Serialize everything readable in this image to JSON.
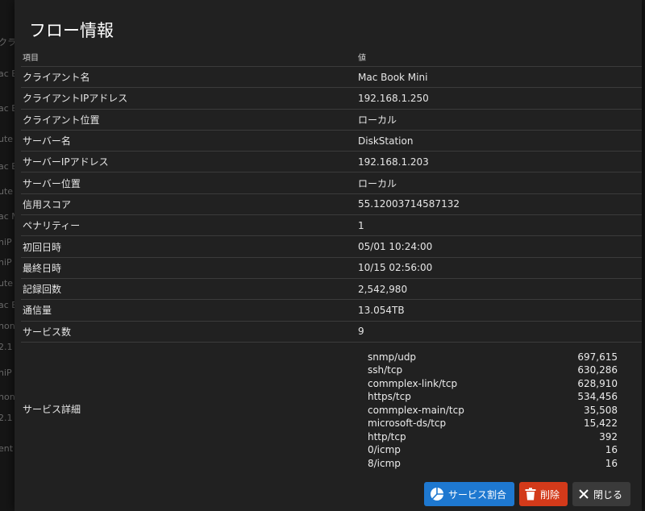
{
  "background_fragments": [
    "クライ",
    "ac B",
    "ac B",
    "ute",
    "ac B",
    "ute",
    "ac M",
    "niP",
    "niP",
    "ute",
    "ac B",
    "hon",
    "2.1",
    "niP",
    "hon",
    "2.1",
    "ent"
  ],
  "dialog": {
    "title": "フロー情報",
    "table": {
      "headers": {
        "item": "項目",
        "value": "値"
      },
      "rows": [
        {
          "label": "クライアント名",
          "value": "Mac Book Mini"
        },
        {
          "label": "クライアントIPアドレス",
          "value": "192.168.1.250"
        },
        {
          "label": "クライアント位置",
          "value": "ローカル"
        },
        {
          "label": "サーバー名",
          "value": "DiskStation"
        },
        {
          "label": "サーバーIPアドレス",
          "value": "192.168.1.203"
        },
        {
          "label": "サーバー位置",
          "value": "ローカル"
        },
        {
          "label": "信用スコア",
          "value": "55.12003714587132"
        },
        {
          "label": "ペナリティー",
          "value": "1"
        },
        {
          "label": "初回日時",
          "value": "05/01 10:24:00"
        },
        {
          "label": "最終日時",
          "value": "10/15 02:56:00"
        },
        {
          "label": "記録回数",
          "value": "2,542,980"
        },
        {
          "label": "通信量",
          "value": "13.054TB"
        },
        {
          "label": "サービス数",
          "value": "9"
        }
      ],
      "service_detail_label": "サービス詳細",
      "services": [
        {
          "name": "snmp/udp",
          "count": "697,615"
        },
        {
          "name": "ssh/tcp",
          "count": "630,286"
        },
        {
          "name": "commplex-link/tcp",
          "count": "628,910"
        },
        {
          "name": "https/tcp",
          "count": "534,456"
        },
        {
          "name": "commplex-main/tcp",
          "count": "35,508"
        },
        {
          "name": "microsoft-ds/tcp",
          "count": "15,422"
        },
        {
          "name": "http/tcp",
          "count": "392"
        },
        {
          "name": "0/icmp",
          "count": "16"
        },
        {
          "name": "8/icmp",
          "count": "16"
        }
      ]
    },
    "buttons": {
      "share": {
        "label": "サービス割合",
        "icon": "pie-chart-icon",
        "color": "#1e78d0"
      },
      "delete": {
        "label": "削除",
        "icon": "trash-icon",
        "color": "#d33a1a"
      },
      "close": {
        "label": "閉じる",
        "icon": "close-icon",
        "color": "#3a3a3a"
      }
    }
  }
}
